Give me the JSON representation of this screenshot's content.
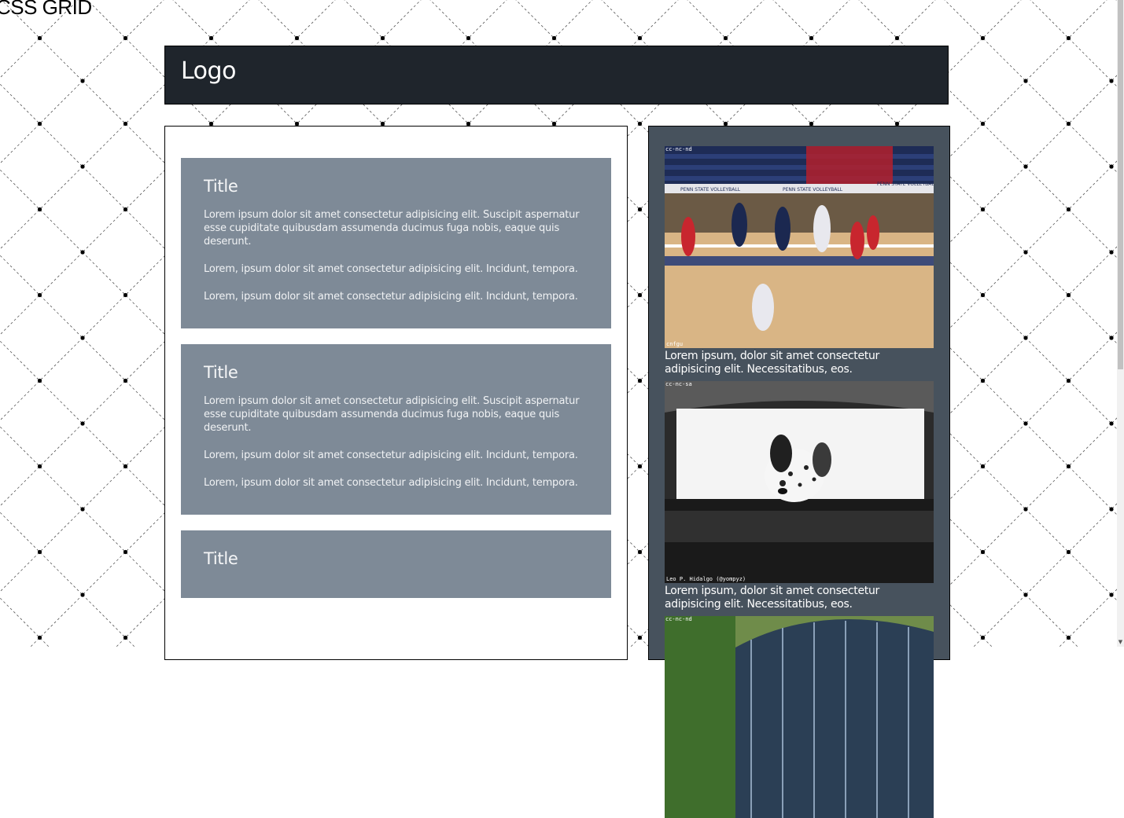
{
  "page": {
    "title": "CSS GRID"
  },
  "header": {
    "logo": "Logo"
  },
  "main": {
    "cards": [
      {
        "title": "Title",
        "paragraphs": [
          "Lorem ipsum dolor sit amet consectetur adipisicing elit. Suscipit aspernatur esse cupiditate quibusdam assumenda ducimus fuga nobis, eaque quis deserunt.",
          "Lorem, ipsum dolor sit amet consectetur adipisicing elit. Incidunt, tempora.",
          "Lorem, ipsum dolor sit amet consectetur adipisicing elit. Incidunt, tempora."
        ]
      },
      {
        "title": "Title",
        "paragraphs": [
          "Lorem ipsum dolor sit amet consectetur adipisicing elit. Suscipit aspernatur esse cupiditate quibusdam assumenda ducimus fuga nobis, eaque quis deserunt.",
          "Lorem, ipsum dolor sit amet consectetur adipisicing elit. Incidunt, tempora.",
          "Lorem, ipsum dolor sit amet consectetur adipisicing elit. Incidunt, tempora."
        ]
      },
      {
        "title": "Title"
      }
    ]
  },
  "aside": {
    "figures": [
      {
        "image": "volleyball-photo",
        "license": "cc-nc-nd",
        "author": "cnfgu",
        "banner": "PENN STATE VOLLEYBALL",
        "caption": "Lorem ipsum, dolor sit amet consectetur adipisicing elit. Necessitatibus, eos."
      },
      {
        "image": "dalmatian-photo",
        "license": "cc-nc-sa",
        "author": "Leo P. Hidalgo (@yompyz)",
        "caption": "Lorem ipsum, dolor sit amet consectetur adipisicing elit. Necessitatibus, eos."
      },
      {
        "image": "greenhouse-photo",
        "license": "cc-nc-nd"
      }
    ]
  },
  "colors": {
    "header_bg": "#1f252c",
    "card_bg": "#7e8a97",
    "aside_bg": "#47525d",
    "page_bg": "#ffffff"
  }
}
